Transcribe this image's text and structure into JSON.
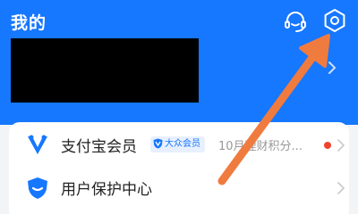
{
  "header": {
    "title": "我的",
    "icons": [
      "customer-service-icon",
      "settings-icon"
    ],
    "background_color": "#1677ff"
  },
  "profile": {
    "name_redacted": true
  },
  "menu": {
    "items": [
      {
        "label": "支付宝会员",
        "icon": "membership-v-icon",
        "badge": "大众会员",
        "promo": "10月理财积分...",
        "has_red_dot": true
      },
      {
        "label": "用户保护中心",
        "icon": "shield-icon"
      }
    ]
  },
  "annotation": {
    "color": "#f07b3f",
    "points_to": "settings-icon"
  }
}
